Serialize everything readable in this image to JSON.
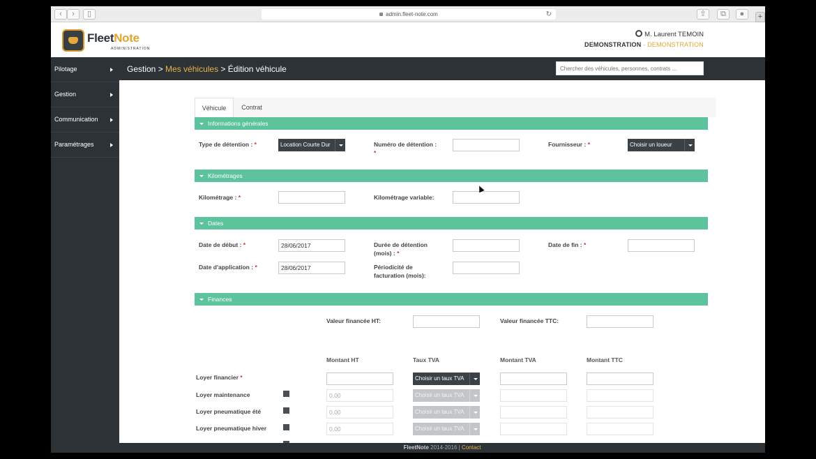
{
  "browser": {
    "url": "admin.fleet-note.com",
    "plus": "+"
  },
  "brand": {
    "name_a": "Fleet",
    "name_b": "Note",
    "sub": "ADMINISTRATION"
  },
  "user": {
    "name": "M. Laurent TEMOIN",
    "account": "DEMONSTRATION",
    "sep": " - ",
    "account2": "DEMONSTRATION"
  },
  "breadcrumb": {
    "a": "Gestion",
    "sep1": " > ",
    "b": "Mes véhicules",
    "sep2": " > ",
    "c": "Édition véhicule"
  },
  "search": {
    "placeholder": "Chercher des véhicules, personnes, contrats ..."
  },
  "sidebar": [
    {
      "label": "Pilotage"
    },
    {
      "label": "Gestion"
    },
    {
      "label": "Communication"
    },
    {
      "label": "Paramétrages"
    }
  ],
  "tabs": [
    {
      "label": "Véhicule"
    },
    {
      "label": "Contrat"
    }
  ],
  "sections": {
    "general": "Informations générales",
    "km": "Kilométrages",
    "dates": "Dates",
    "finances": "Finances"
  },
  "general": {
    "type_label": "Type de détention :",
    "type_value": "Location Courte Dur",
    "numero_label": "Numéro de détention :",
    "fournisseur_label": "Fournisseur :",
    "fournisseur_value": "Choisir un loueur"
  },
  "km": {
    "km_label": "Kilométrage :",
    "km_var_label": "Kilométrage variable:"
  },
  "dates": {
    "debut_label": "Date de début :",
    "debut_value": "28/06/2017",
    "duree_label_1": "Durée de détention",
    "duree_label_2": "(mois) :",
    "fin_label": "Date de fin :",
    "application_label": "Date d'application :",
    "application_value": "28/06/2017",
    "periodicite_label_1": "Périodicité de",
    "periodicite_label_2": "facturation (mois):"
  },
  "finances": {
    "valeur_ht_label": "Valeur financée HT:",
    "valeur_ttc_label": "Valeur financée TTC:",
    "columns": [
      "Montant HT",
      "Taux TVA",
      "Montant TVA",
      "Montant TTC"
    ],
    "rows": [
      {
        "label": "Loyer financier",
        "required": true,
        "montant_ht": "",
        "taux": "Choisir un taux TVA",
        "dim": false
      },
      {
        "label": "Loyer maintenance",
        "required": false,
        "montant_ht": "0,00",
        "taux": "Choisir un taux TVA",
        "dim": true
      },
      {
        "label": "Loyer pneumatique été",
        "required": false,
        "montant_ht": "0,00",
        "taux": "Choisir un taux TVA",
        "dim": true
      },
      {
        "label": "Loyer pneumatique hiver",
        "required": false,
        "montant_ht": "0,00",
        "taux": "Choisir un taux TVA",
        "dim": true
      }
    ]
  },
  "footer": {
    "brand": "FleetNote",
    "years": " 2014-2016 | ",
    "contact": "Contact"
  }
}
